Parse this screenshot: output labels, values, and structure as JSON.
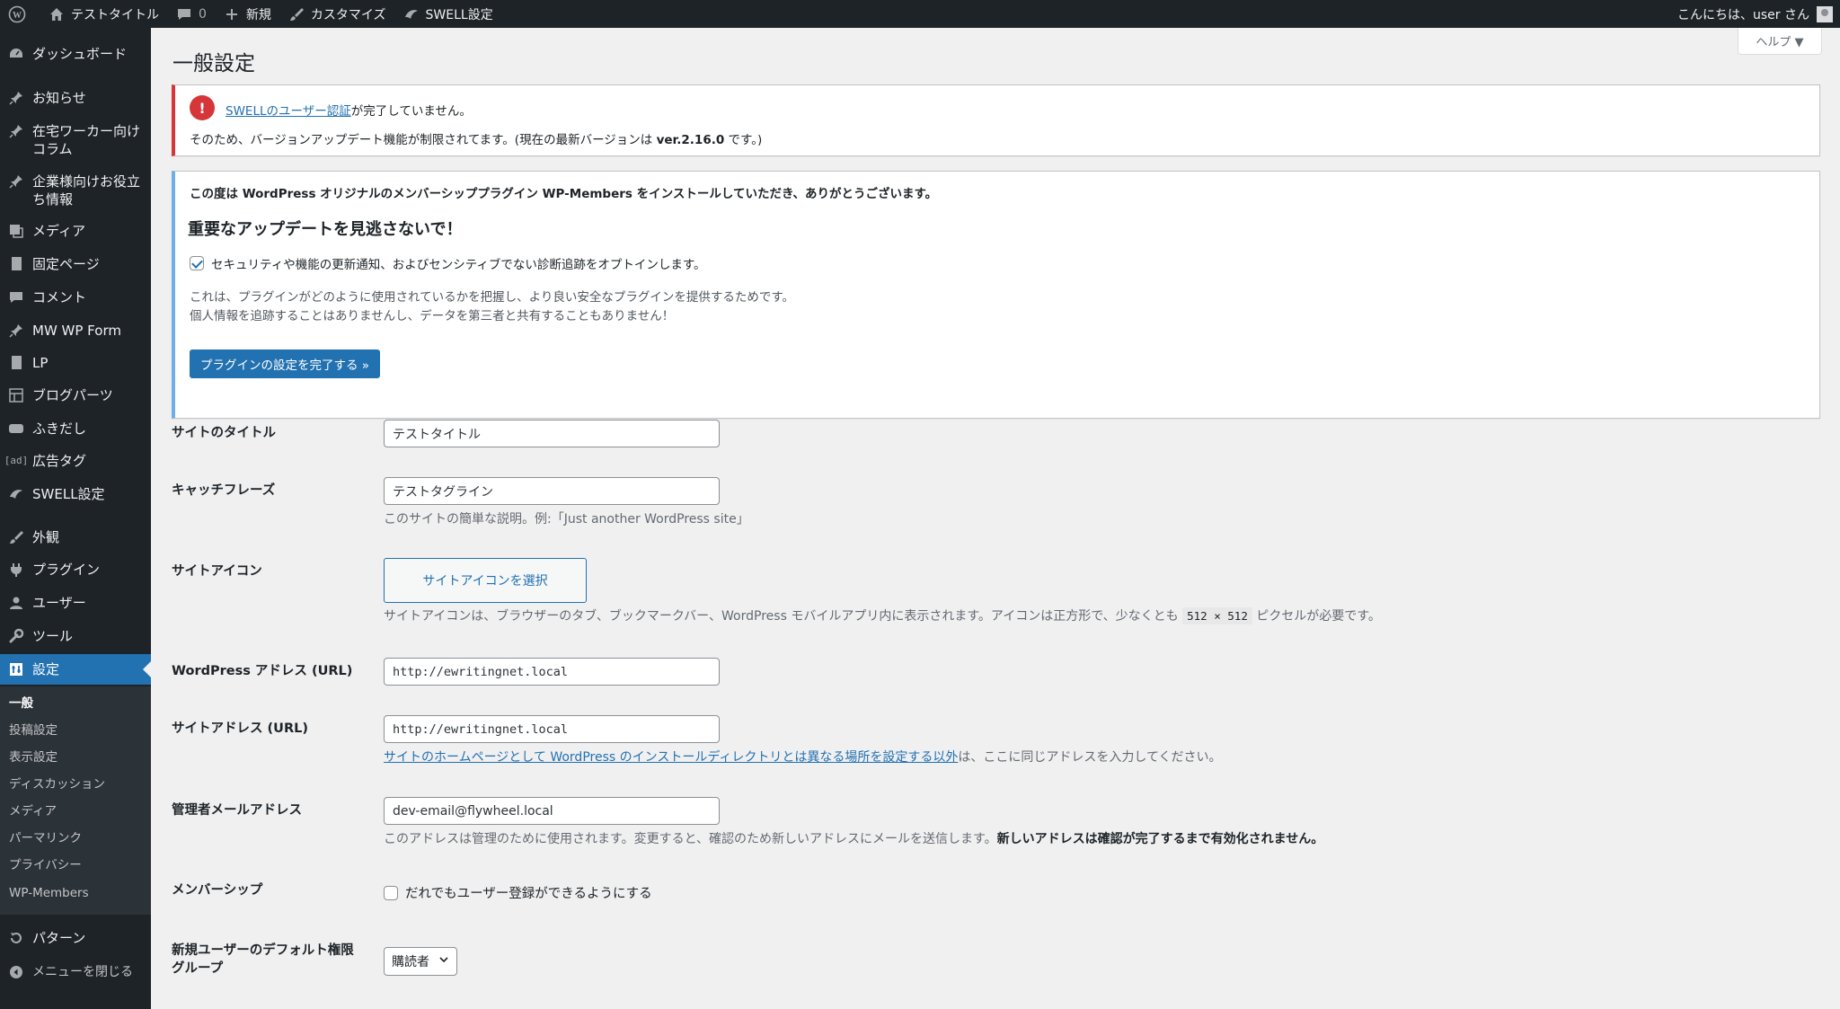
{
  "admin_bar": {
    "site_name": "テストタイトル",
    "comments_count": "0",
    "new_label": "新規",
    "customize_label": "カスタマイズ",
    "swell_label": "SWELL設定",
    "greeting": "こんにちは、user さん"
  },
  "sidebar": {
    "items": [
      {
        "label": "ダッシュボード",
        "icon": "dashboard-icon"
      },
      {
        "label": "お知らせ",
        "icon": "pin-icon"
      },
      {
        "label": "在宅ワーカー向け\nコラム",
        "icon": "pin-icon"
      },
      {
        "label": "企業様向けお役立\nち情報",
        "icon": "pin-icon"
      },
      {
        "label": "メディア",
        "icon": "media-icon"
      },
      {
        "label": "固定ページ",
        "icon": "page-icon"
      },
      {
        "label": "コメント",
        "icon": "comment-icon"
      },
      {
        "label": "MW WP Form",
        "icon": "pin-icon"
      },
      {
        "label": "LP",
        "icon": "page-icon"
      },
      {
        "label": "ブログパーツ",
        "icon": "layout-icon"
      },
      {
        "label": "ふきだし",
        "icon": "speech-bubble-icon"
      },
      {
        "label": "広告タグ",
        "icon": "ad-icon"
      },
      {
        "label": "SWELL設定",
        "icon": "swell-icon"
      },
      {
        "label": "外観",
        "icon": "paintbrush-icon"
      },
      {
        "label": "プラグイン",
        "icon": "plugin-icon"
      },
      {
        "label": "ユーザー",
        "icon": "user-icon"
      },
      {
        "label": "ツール",
        "icon": "wrench-icon"
      },
      {
        "label": "設定",
        "icon": "settings-icon"
      },
      {
        "label": "パターン",
        "icon": "pattern-icon"
      },
      {
        "label": "メニューを閉じる",
        "icon": "collapse-icon"
      }
    ],
    "submenu": [
      "一般",
      "投稿設定",
      "表示設定",
      "ディスカッション",
      "メディア",
      "パーマリンク",
      "プライバシー",
      "WP-Members"
    ]
  },
  "page": {
    "title": "一般設定",
    "help_label": "ヘルプ ▼"
  },
  "swell_notice": {
    "link_text": "SWELLのユーザー認証",
    "line1_rest": "が完了していません。",
    "line2_prefix": "そのため、バージョンアップデート機能が制限されてます。(現在の最新バージョンは ",
    "version": "ver.2.16.0",
    "line2_suffix": " です。)"
  },
  "wpm_notice": {
    "intro": "この度は WordPress オリジナルのメンバーシッププラグイン WP-Members をインストールしていただき、ありがとうございます。",
    "heading": "重要なアップデートを見逃さないで！",
    "optin_label": "セキュリティや機能の更新通知、およびセンシティブでない診断追跡をオプトインします。",
    "optin_checked": true,
    "desc1": "これは、プラグインがどのように使用されているかを把握し、より良い安全なプラグインを提供するためです。",
    "desc2": "個人情報を追跡することはありませんし、データを第三者と共有することもありません！",
    "button": "プラグインの設定を完了する »"
  },
  "form": {
    "site_title": {
      "label": "サイトのタイトル",
      "value": "テストタイトル"
    },
    "tagline": {
      "label": "キャッチフレーズ",
      "value": "テストタグライン",
      "desc": "このサイトの簡単な説明。例:「Just another WordPress site」"
    },
    "site_icon": {
      "label": "サイトアイコン",
      "button": "サイトアイコンを選択",
      "desc_before": "サイトアイコンは、ブラウザーのタブ、ブックマークバー、WordPress モバイルアプリ内に表示されます。アイコンは正方形で、少なくとも ",
      "size": "512 × 512",
      "desc_after": " ピクセルが必要です。"
    },
    "wp_address": {
      "label": "WordPress アドレス (URL)",
      "value": "http://ewritingnet.local"
    },
    "site_address": {
      "label": "サイトアドレス (URL)",
      "value": "http://ewritingnet.local",
      "link_text": "サイトのホームページとして WordPress のインストールディレクトリとは異なる場所を設定する以外",
      "desc_rest": "は、ここに同じアドレスを入力してください。"
    },
    "admin_email": {
      "label": "管理者メールアドレス",
      "value": "dev-email@flywheel.local",
      "desc": "このアドレスは管理のために使用されます。変更すると、確認のため新しいアドレスにメールを送信します。",
      "desc_bold": "新しいアドレスは確認が完了するまで有効化されません。"
    },
    "membership": {
      "label": "メンバーシップ",
      "checkbox_label": "だれでもユーザー登録ができるようにする",
      "checked": false
    },
    "default_role": {
      "label": "新規ユーザーのデフォルト権限\nグループ",
      "value": "購読者"
    }
  },
  "colors": {
    "accent": "#2271b1",
    "admin_bar": "#1d2327",
    "error": "#d63638",
    "info": "#72aee6"
  }
}
